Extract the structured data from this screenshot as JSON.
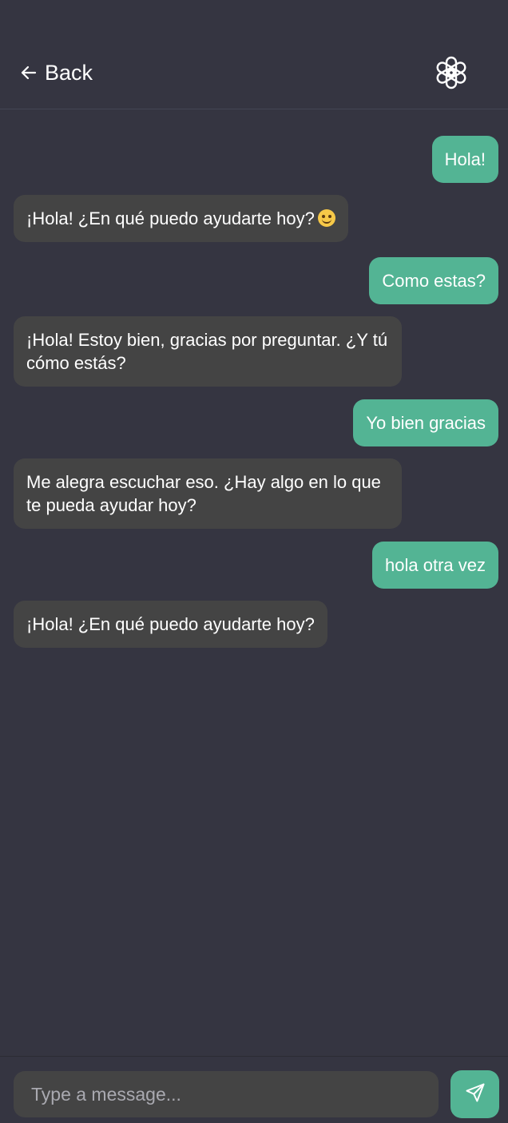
{
  "header": {
    "back_label": "Back",
    "back_icon": "arrow-left-icon",
    "logo_icon": "openai-logo-icon"
  },
  "messages": [
    {
      "role": "user",
      "text": "Hola!"
    },
    {
      "role": "assistant",
      "text": "¡Hola! ¿En qué puedo ayudarte hoy?",
      "emoji": "smiling-face-emoji"
    },
    {
      "role": "user",
      "text": "Como estas?"
    },
    {
      "role": "assistant",
      "text": "¡Hola! Estoy bien, gracias por preguntar. ¿Y tú cómo estás?"
    },
    {
      "role": "user",
      "text": "Yo bien gracias"
    },
    {
      "role": "assistant",
      "text": "Me alegra escuchar eso. ¿Hay algo en lo que te pueda ayudar hoy?"
    },
    {
      "role": "user",
      "text": "hola otra vez"
    },
    {
      "role": "assistant",
      "text": "¡Hola! ¿En qué puedo ayudarte hoy?"
    }
  ],
  "composer": {
    "placeholder": "Type a message...",
    "value": "",
    "send_icon": "send-icon"
  },
  "colors": {
    "background": "#353541",
    "user_bubble": "#53b494",
    "assistant_bubble": "#444444",
    "accent": "#53b494"
  }
}
